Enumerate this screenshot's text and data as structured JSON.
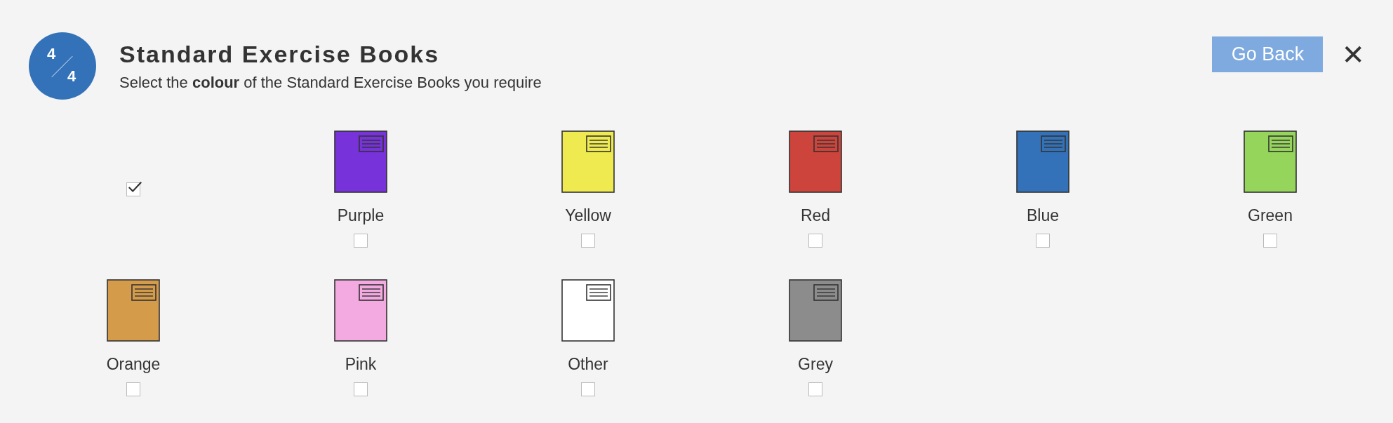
{
  "header": {
    "step": {
      "current": "4",
      "total": "4"
    },
    "title": "Standard Exercise Books",
    "subtitle": "Select the **colour** of the Standard Exercise Books you require"
  },
  "actions": {
    "back_button": "Go Back",
    "close": "✕"
  },
  "options": [
    {
      "kind": "checkbox",
      "checked": true
    },
    {
      "kind": "book",
      "label": "Purple",
      "color": "#7732d9",
      "checked": false
    },
    {
      "kind": "book",
      "label": "Yellow",
      "color": "#eeea50",
      "checked": false
    },
    {
      "kind": "book",
      "label": "Red",
      "color": "#cc443b",
      "checked": false
    },
    {
      "kind": "book",
      "label": "Blue",
      "color": "#3372b9",
      "checked": false
    },
    {
      "kind": "book",
      "label": "Green",
      "color": "#96d55c",
      "checked": false
    },
    {
      "kind": "book",
      "label": "Orange",
      "color": "#d49c4a",
      "checked": false
    },
    {
      "kind": "book",
      "label": "Pink",
      "color": "#f2aae0",
      "checked": false
    },
    {
      "kind": "book",
      "label": "Other",
      "color": "#ffffff",
      "checked": false
    },
    {
      "kind": "book",
      "label": "Grey",
      "color": "#8c8c8c",
      "checked": false
    }
  ]
}
